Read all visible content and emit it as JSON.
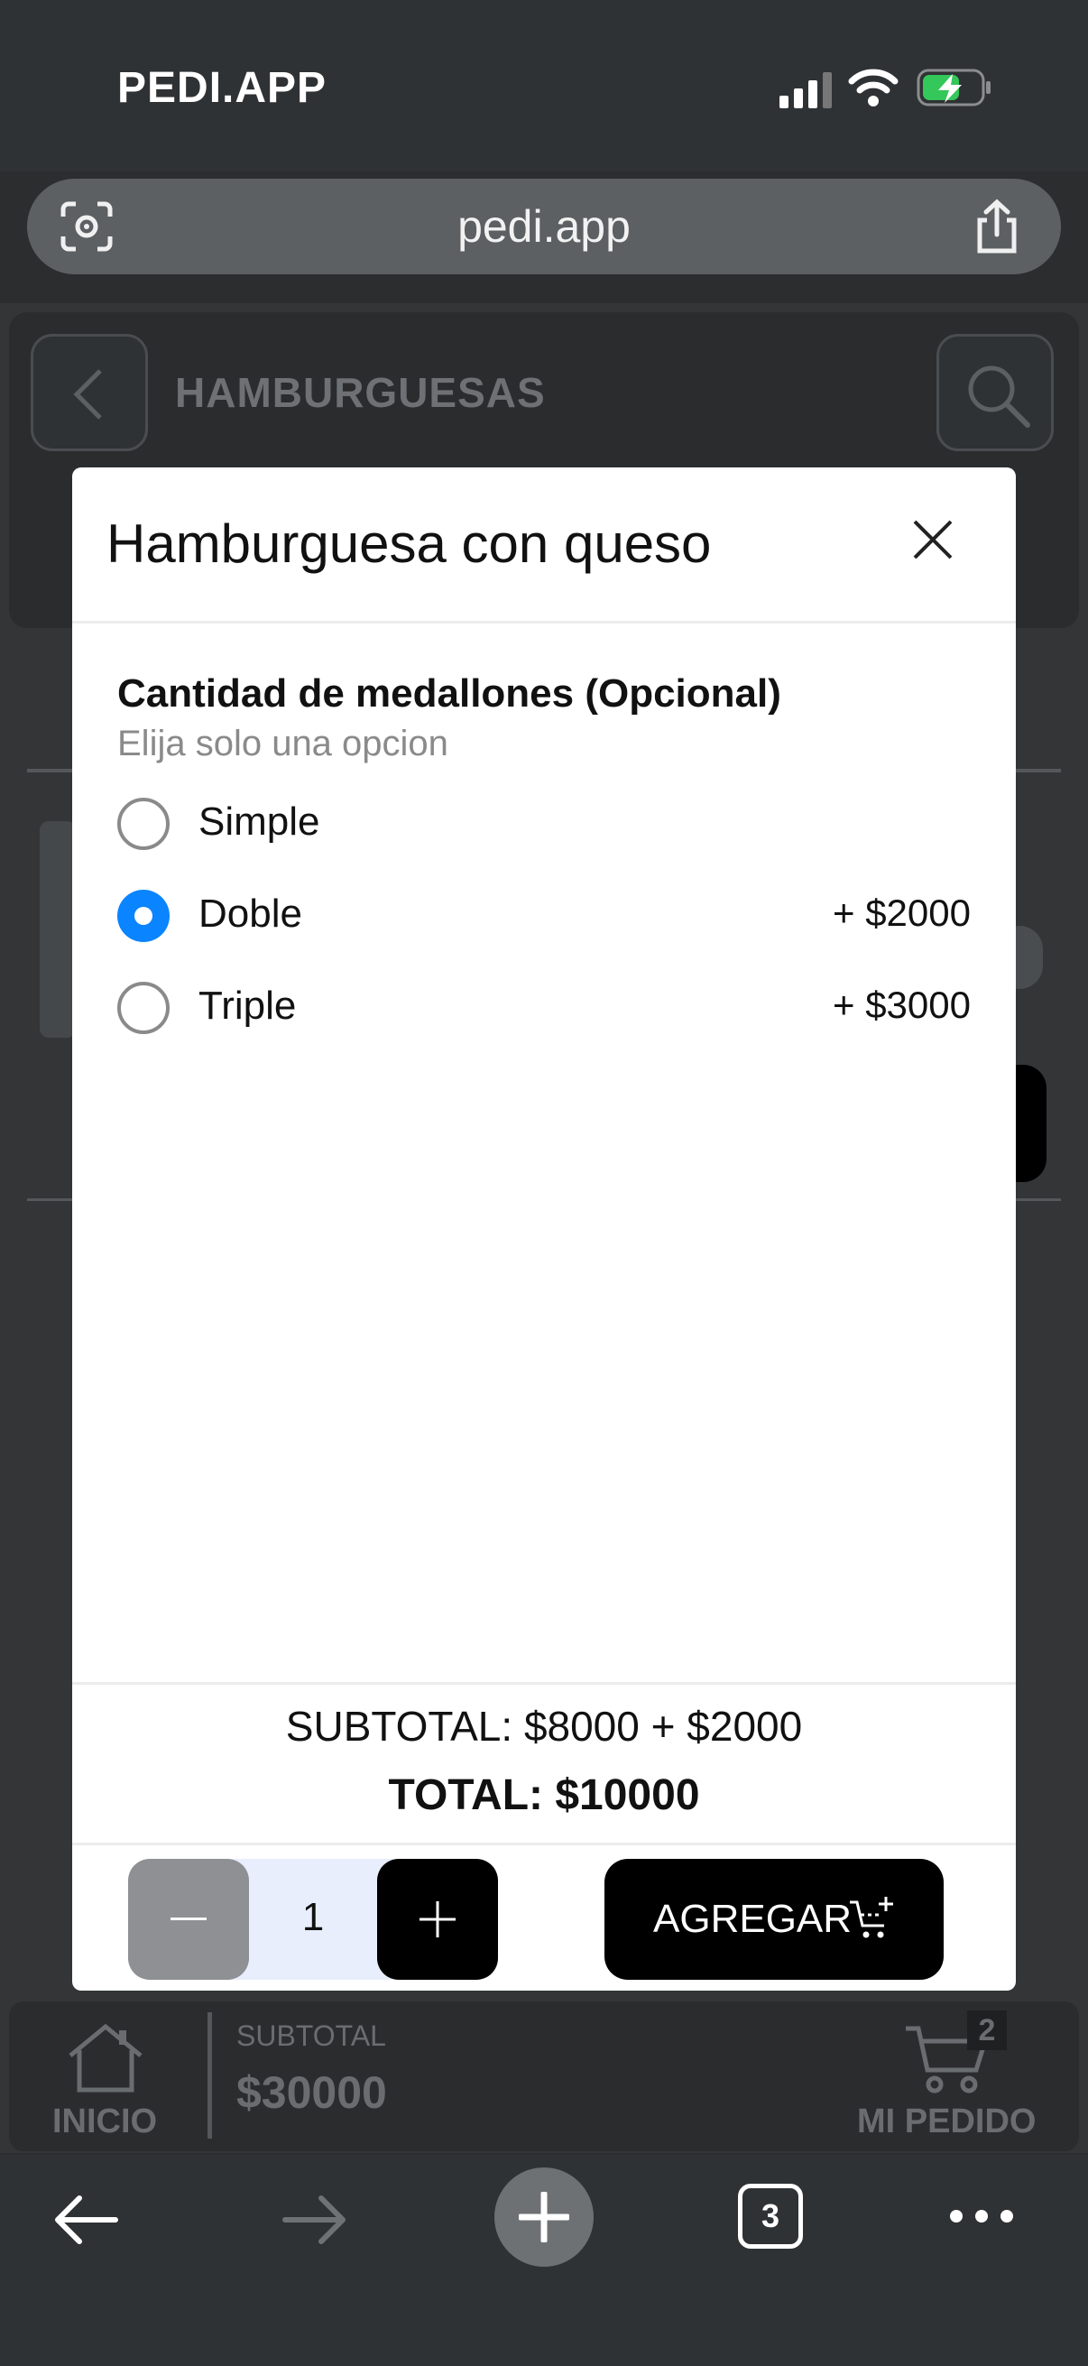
{
  "status_bar": {
    "carrier": "PEDI.APP"
  },
  "browser": {
    "url": "pedi.app",
    "tabs_count": "3"
  },
  "page": {
    "category_title": "HAMBURGUESAS"
  },
  "modal": {
    "title": "Hamburguesa con queso",
    "group": {
      "title": "Cantidad de medallones (Opcional)",
      "subtitle": "Elija solo una opcion",
      "options": [
        {
          "label": "Simple",
          "price": "",
          "selected": false
        },
        {
          "label": "Doble",
          "price": "+ $2000",
          "selected": true
        },
        {
          "label": "Triple",
          "price": "+ $3000",
          "selected": false
        }
      ]
    },
    "subtotal_line": "SUBTOTAL: $8000 + $2000",
    "total_line": "TOTAL: $10000",
    "quantity": "1",
    "add_label": "AGREGAR"
  },
  "app_nav": {
    "home_label": "INICIO",
    "subtotal_caption": "SUBTOTAL",
    "subtotal_value": "$30000",
    "cart_label": "MI PEDIDO",
    "cart_count": "2"
  },
  "colors": {
    "accent": "#0a84ff",
    "battery": "#34c759"
  }
}
